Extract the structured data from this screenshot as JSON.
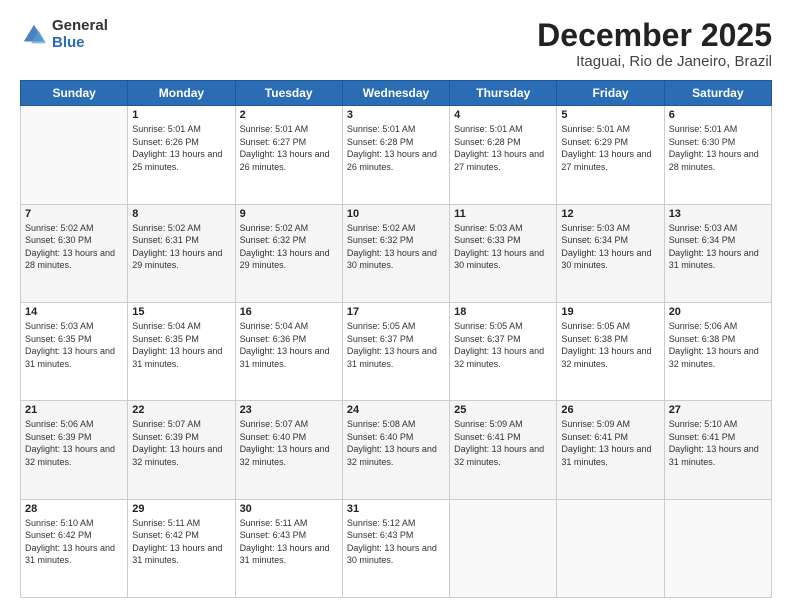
{
  "logo": {
    "general": "General",
    "blue": "Blue"
  },
  "header": {
    "month": "December 2025",
    "location": "Itaguai, Rio de Janeiro, Brazil"
  },
  "weekdays": [
    "Sunday",
    "Monday",
    "Tuesday",
    "Wednesday",
    "Thursday",
    "Friday",
    "Saturday"
  ],
  "days": [
    {
      "num": "",
      "sunrise": "",
      "sunset": "",
      "daylight": ""
    },
    {
      "num": "1",
      "sunrise": "Sunrise: 5:01 AM",
      "sunset": "Sunset: 6:26 PM",
      "daylight": "Daylight: 13 hours and 25 minutes."
    },
    {
      "num": "2",
      "sunrise": "Sunrise: 5:01 AM",
      "sunset": "Sunset: 6:27 PM",
      "daylight": "Daylight: 13 hours and 26 minutes."
    },
    {
      "num": "3",
      "sunrise": "Sunrise: 5:01 AM",
      "sunset": "Sunset: 6:28 PM",
      "daylight": "Daylight: 13 hours and 26 minutes."
    },
    {
      "num": "4",
      "sunrise": "Sunrise: 5:01 AM",
      "sunset": "Sunset: 6:28 PM",
      "daylight": "Daylight: 13 hours and 27 minutes."
    },
    {
      "num": "5",
      "sunrise": "Sunrise: 5:01 AM",
      "sunset": "Sunset: 6:29 PM",
      "daylight": "Daylight: 13 hours and 27 minutes."
    },
    {
      "num": "6",
      "sunrise": "Sunrise: 5:01 AM",
      "sunset": "Sunset: 6:30 PM",
      "daylight": "Daylight: 13 hours and 28 minutes."
    },
    {
      "num": "7",
      "sunrise": "Sunrise: 5:02 AM",
      "sunset": "Sunset: 6:30 PM",
      "daylight": "Daylight: 13 hours and 28 minutes."
    },
    {
      "num": "8",
      "sunrise": "Sunrise: 5:02 AM",
      "sunset": "Sunset: 6:31 PM",
      "daylight": "Daylight: 13 hours and 29 minutes."
    },
    {
      "num": "9",
      "sunrise": "Sunrise: 5:02 AM",
      "sunset": "Sunset: 6:32 PM",
      "daylight": "Daylight: 13 hours and 29 minutes."
    },
    {
      "num": "10",
      "sunrise": "Sunrise: 5:02 AM",
      "sunset": "Sunset: 6:32 PM",
      "daylight": "Daylight: 13 hours and 30 minutes."
    },
    {
      "num": "11",
      "sunrise": "Sunrise: 5:03 AM",
      "sunset": "Sunset: 6:33 PM",
      "daylight": "Daylight: 13 hours and 30 minutes."
    },
    {
      "num": "12",
      "sunrise": "Sunrise: 5:03 AM",
      "sunset": "Sunset: 6:34 PM",
      "daylight": "Daylight: 13 hours and 30 minutes."
    },
    {
      "num": "13",
      "sunrise": "Sunrise: 5:03 AM",
      "sunset": "Sunset: 6:34 PM",
      "daylight": "Daylight: 13 hours and 31 minutes."
    },
    {
      "num": "14",
      "sunrise": "Sunrise: 5:03 AM",
      "sunset": "Sunset: 6:35 PM",
      "daylight": "Daylight: 13 hours and 31 minutes."
    },
    {
      "num": "15",
      "sunrise": "Sunrise: 5:04 AM",
      "sunset": "Sunset: 6:35 PM",
      "daylight": "Daylight: 13 hours and 31 minutes."
    },
    {
      "num": "16",
      "sunrise": "Sunrise: 5:04 AM",
      "sunset": "Sunset: 6:36 PM",
      "daylight": "Daylight: 13 hours and 31 minutes."
    },
    {
      "num": "17",
      "sunrise": "Sunrise: 5:05 AM",
      "sunset": "Sunset: 6:37 PM",
      "daylight": "Daylight: 13 hours and 31 minutes."
    },
    {
      "num": "18",
      "sunrise": "Sunrise: 5:05 AM",
      "sunset": "Sunset: 6:37 PM",
      "daylight": "Daylight: 13 hours and 32 minutes."
    },
    {
      "num": "19",
      "sunrise": "Sunrise: 5:05 AM",
      "sunset": "Sunset: 6:38 PM",
      "daylight": "Daylight: 13 hours and 32 minutes."
    },
    {
      "num": "20",
      "sunrise": "Sunrise: 5:06 AM",
      "sunset": "Sunset: 6:38 PM",
      "daylight": "Daylight: 13 hours and 32 minutes."
    },
    {
      "num": "21",
      "sunrise": "Sunrise: 5:06 AM",
      "sunset": "Sunset: 6:39 PM",
      "daylight": "Daylight: 13 hours and 32 minutes."
    },
    {
      "num": "22",
      "sunrise": "Sunrise: 5:07 AM",
      "sunset": "Sunset: 6:39 PM",
      "daylight": "Daylight: 13 hours and 32 minutes."
    },
    {
      "num": "23",
      "sunrise": "Sunrise: 5:07 AM",
      "sunset": "Sunset: 6:40 PM",
      "daylight": "Daylight: 13 hours and 32 minutes."
    },
    {
      "num": "24",
      "sunrise": "Sunrise: 5:08 AM",
      "sunset": "Sunset: 6:40 PM",
      "daylight": "Daylight: 13 hours and 32 minutes."
    },
    {
      "num": "25",
      "sunrise": "Sunrise: 5:09 AM",
      "sunset": "Sunset: 6:41 PM",
      "daylight": "Daylight: 13 hours and 32 minutes."
    },
    {
      "num": "26",
      "sunrise": "Sunrise: 5:09 AM",
      "sunset": "Sunset: 6:41 PM",
      "daylight": "Daylight: 13 hours and 31 minutes."
    },
    {
      "num": "27",
      "sunrise": "Sunrise: 5:10 AM",
      "sunset": "Sunset: 6:41 PM",
      "daylight": "Daylight: 13 hours and 31 minutes."
    },
    {
      "num": "28",
      "sunrise": "Sunrise: 5:10 AM",
      "sunset": "Sunset: 6:42 PM",
      "daylight": "Daylight: 13 hours and 31 minutes."
    },
    {
      "num": "29",
      "sunrise": "Sunrise: 5:11 AM",
      "sunset": "Sunset: 6:42 PM",
      "daylight": "Daylight: 13 hours and 31 minutes."
    },
    {
      "num": "30",
      "sunrise": "Sunrise: 5:11 AM",
      "sunset": "Sunset: 6:43 PM",
      "daylight": "Daylight: 13 hours and 31 minutes."
    },
    {
      "num": "31",
      "sunrise": "Sunrise: 5:12 AM",
      "sunset": "Sunset: 6:43 PM",
      "daylight": "Daylight: 13 hours and 30 minutes."
    }
  ]
}
